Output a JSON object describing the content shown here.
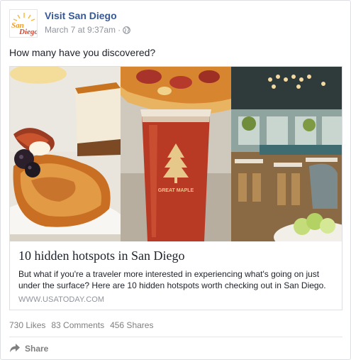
{
  "post": {
    "page_name": "Visit San Diego",
    "timestamp": "March 7 at 9:37am",
    "separator": "·",
    "privacy_icon": "globe-icon",
    "text": "How many have you discovered?",
    "avatar_logo_text": "SanDiego"
  },
  "link_card": {
    "images": [
      "dessert-photo",
      "bloody-mary-photo",
      "restaurant-interior-photo"
    ],
    "title": "10 hidden hotspots in San Diego",
    "description": "But what if you're a traveler more interested in experiencing what's going on just under the surface? Here are 10 hidden hotspots worth checking out in San Diego.",
    "domain": "WWW.USATODAY.COM",
    "glass_text": "GREAT MAPLE"
  },
  "stats": {
    "likes": "730 Likes",
    "comments": "83 Comments",
    "shares": "456 Shares"
  },
  "actions": {
    "share_label": "Share",
    "share_icon": "share-arrow-icon"
  },
  "colors": {
    "link_blue": "#365899",
    "meta_gray": "#90949c",
    "logo_orange": "#f39a1e",
    "logo_red": "#e2452b"
  }
}
